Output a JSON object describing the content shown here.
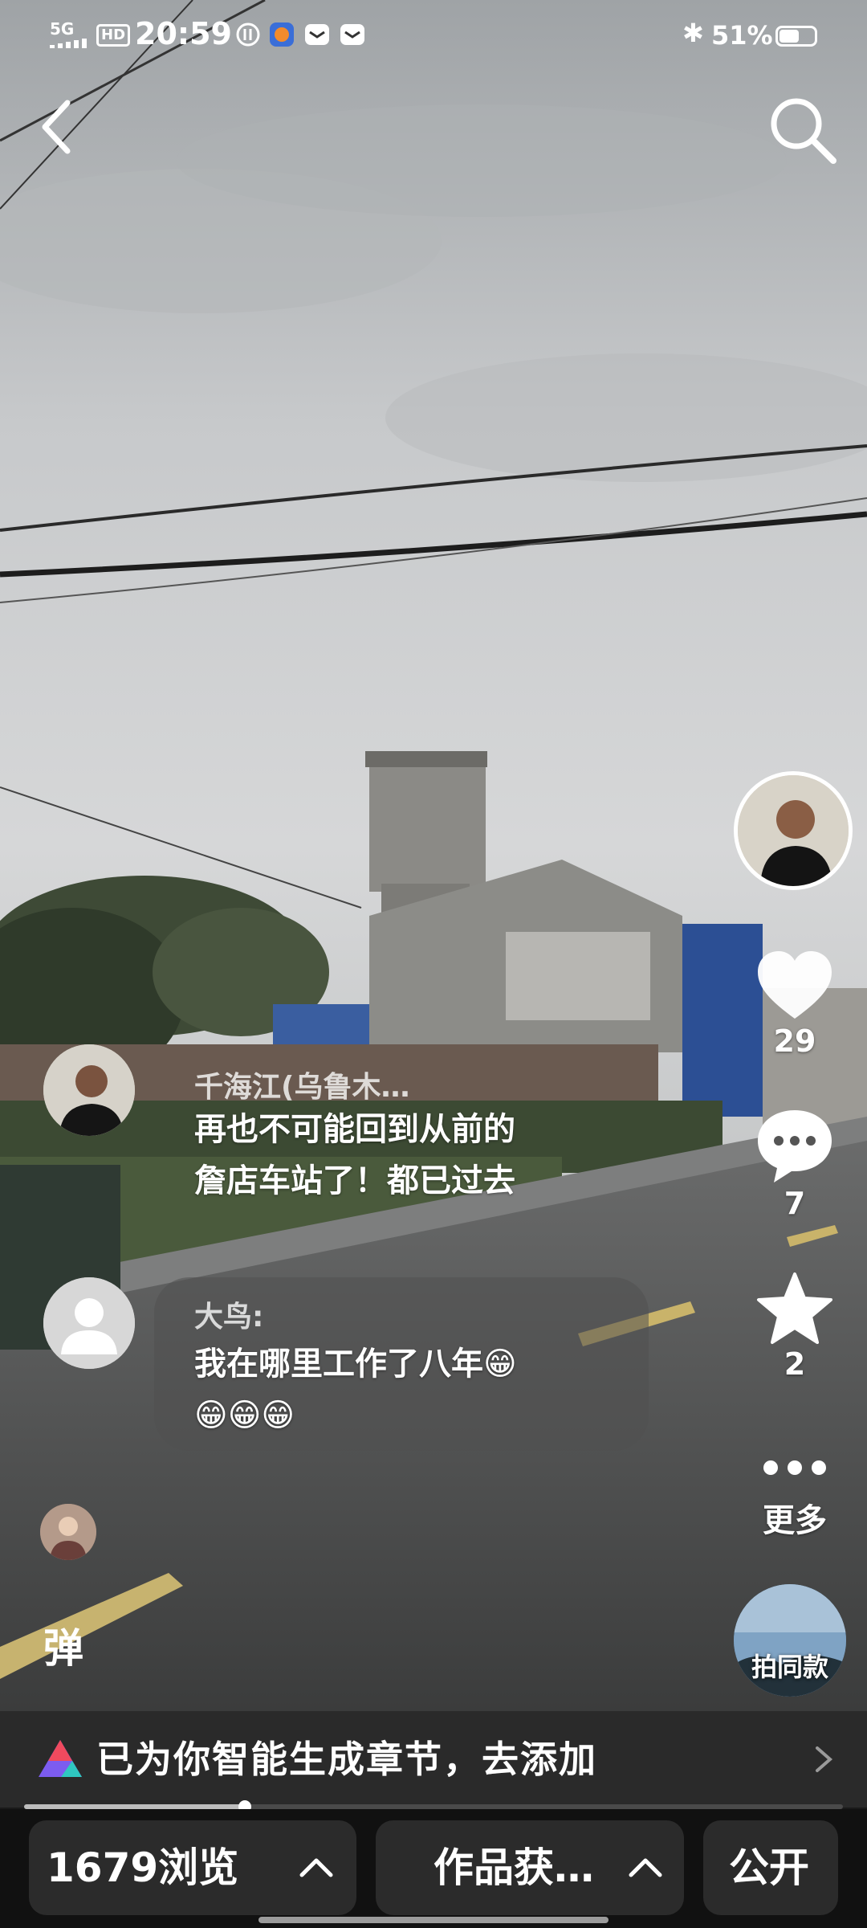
{
  "status_bar": {
    "network": "5G",
    "hd": "HD",
    "time": "20:59",
    "battery": "51%"
  },
  "author": {
    "avatar_icon": "person-avatar"
  },
  "actions": {
    "likes": "29",
    "comments": "7",
    "favorites": "2",
    "more_label": "更多",
    "same_style_label": "拍同款"
  },
  "comments": [
    {
      "name": "千海江(乌鲁木…",
      "text_line1": "再也不可能回到从前的",
      "text_line2": "詹店车站了！都已过去"
    },
    {
      "name": "大鸟:",
      "text_line1": "我在哪里工作了八年😁",
      "text_line2": "😁😁😁"
    }
  ],
  "danmu_label": "弹",
  "chapter_banner": {
    "text": "已为你智能生成章节，去添加",
    "progress": 0.27
  },
  "bottom_bar": {
    "views": "1679浏览",
    "works": "作品获…",
    "visibility": "公开"
  },
  "colors": {
    "sky": "#c9ccce",
    "road": "#5e5f60",
    "heart": "#ffffff",
    "chapter_logo": [
      "#f04a5e",
      "#7c5cf0",
      "#2fc7c0"
    ]
  }
}
